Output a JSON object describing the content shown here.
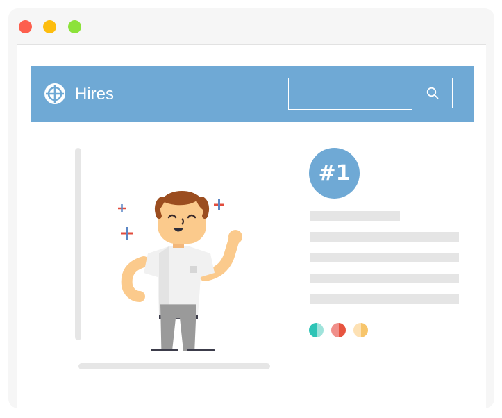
{
  "app": {
    "title": "Hires",
    "logo_icon": "crosshair-target-icon",
    "accent_color": "#6fa9d5"
  },
  "window": {
    "controls": [
      {
        "name": "close",
        "color": "#fd5f4d"
      },
      {
        "name": "minimize",
        "color": "#fdbd0e"
      },
      {
        "name": "maximize",
        "color": "#8ce23a"
      }
    ]
  },
  "search": {
    "value": "",
    "placeholder": "",
    "button_icon": "search-icon"
  },
  "profile": {
    "rank": "#1",
    "illustration": "happy-man-flexing-icon"
  },
  "swatches": [
    {
      "left": "#2ec4b6",
      "right": "#9fe3db"
    },
    {
      "left": "#f08f8a",
      "right": "#e7543f"
    },
    {
      "left": "#fde1b4",
      "right": "#f7c56b"
    }
  ]
}
